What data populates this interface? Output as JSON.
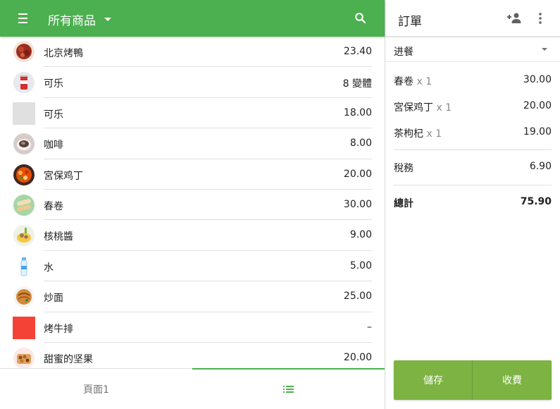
{
  "header": {
    "title": "所有商品",
    "menu_icon": "menu-icon",
    "dropdown_icon": "chevron-down-icon",
    "search_icon": "search-icon",
    "color": "#4caf50"
  },
  "products": [
    {
      "name": "北京烤鴨",
      "price": "23.40",
      "thumb": "duck"
    },
    {
      "name": "可乐",
      "price": "8 變體",
      "thumb": "cola-can"
    },
    {
      "name": "可乐",
      "price": "18.00",
      "thumb": "gray-square"
    },
    {
      "name": "咖啡",
      "price": "8.00",
      "thumb": "coffee"
    },
    {
      "name": "宮保鸡丁",
      "price": "20.00",
      "thumb": "kungpao"
    },
    {
      "name": "春卷",
      "price": "30.00",
      "thumb": "springroll"
    },
    {
      "name": "核桃醬",
      "price": "9.00",
      "thumb": "walnut"
    },
    {
      "name": "水",
      "price": "5.00",
      "thumb": "water"
    },
    {
      "name": "炒面",
      "price": "25.00",
      "thumb": "noodles"
    },
    {
      "name": "烤牛排",
      "price": "–",
      "thumb": "red-square"
    },
    {
      "name": "甜蜜的坚果",
      "price": "20.00",
      "thumb": "nuts"
    }
  ],
  "tabs": {
    "page1": "頁面1",
    "list_icon": "list-icon"
  },
  "order": {
    "title": "訂單",
    "add_person_icon": "add-person-icon",
    "more_icon": "more-vert-icon",
    "dining_option": "进餐",
    "items": [
      {
        "name": "春卷",
        "qty": "x 1",
        "price": "30.00"
      },
      {
        "name": "宮保鸡丁",
        "qty": "x 1",
        "price": "20.00"
      },
      {
        "name": "茶枸杞",
        "qty": "x 1",
        "price": "19.00"
      }
    ],
    "tax_label": "稅務",
    "tax_value": "6.90",
    "total_label": "總計",
    "total_value": "75.90",
    "save_label": "儲存",
    "charge_label": "收費",
    "button_color": "#7cb342"
  }
}
